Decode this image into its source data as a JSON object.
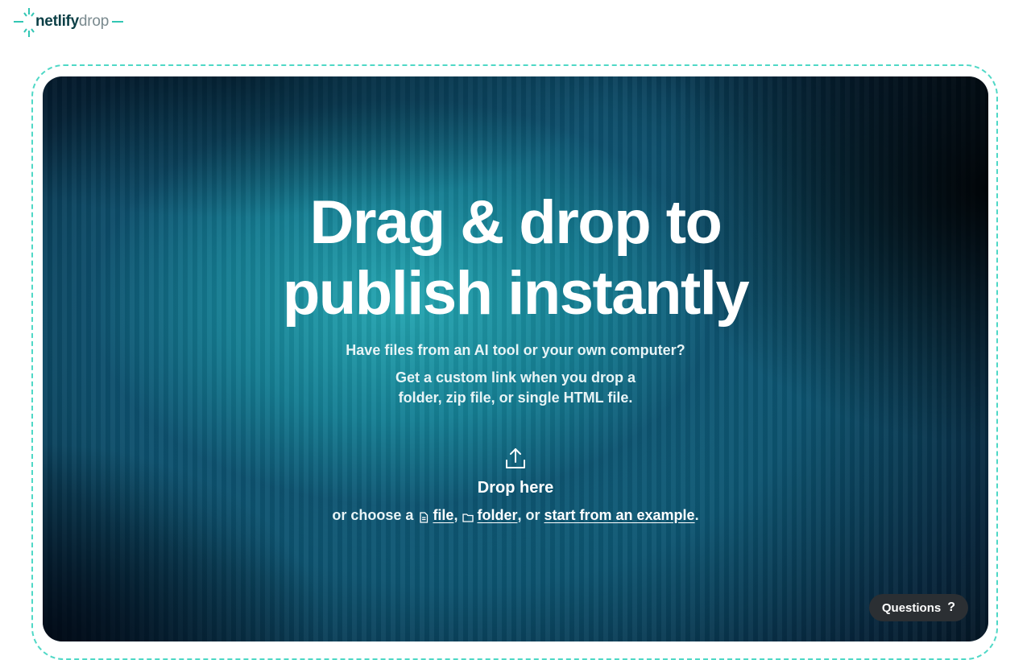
{
  "logo": {
    "part1": "netlify",
    "part2": "drop"
  },
  "hero": {
    "headline_line1": "Drag & drop to",
    "headline_line2": "publish instantly",
    "subtitle": "Have files from an AI tool or your own computer?",
    "description_line1": "Get a custom link when you drop a",
    "description_line2": "folder, zip file, or single HTML file.",
    "drop_label": "Drop here",
    "choose_prefix": "or choose a",
    "file_link": "file",
    "separator1": ",",
    "folder_link": "folder",
    "separator2": ", or",
    "example_link": "start from an example",
    "end_period": "."
  },
  "help": {
    "questions_label": "Questions",
    "questions_icon": "?"
  },
  "icons": {
    "upload": "upload-icon",
    "file": "file-icon",
    "folder": "folder-icon"
  },
  "colors": {
    "accent": "#32c6b4",
    "dashed_border": "#4fd8c6",
    "questions_bg": "#2b2f33"
  }
}
